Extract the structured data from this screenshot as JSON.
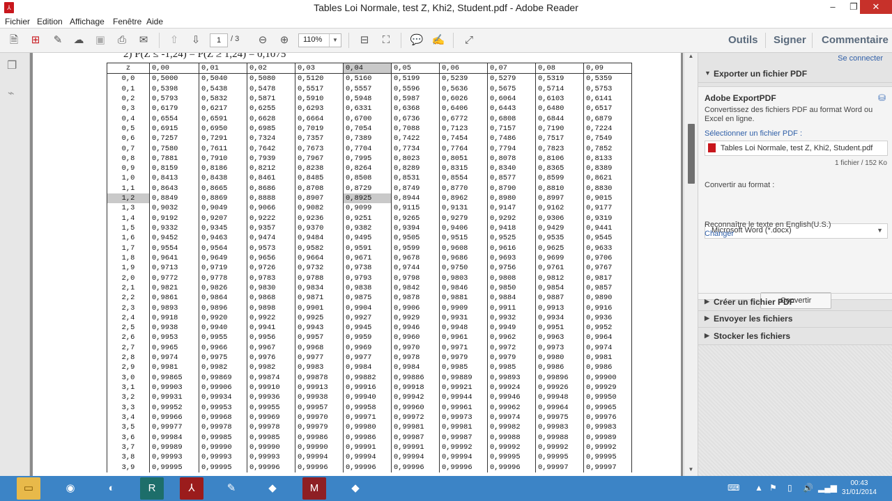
{
  "window": {
    "title": "Tables Loi Normale, test Z, Khi2, Student.pdf - Adobe Reader"
  },
  "menu": [
    "Fichier",
    "Edition",
    "Affichage",
    "Fenêtre",
    "Aide"
  ],
  "toolbar": {
    "page_current": "1",
    "page_total": "/ 3",
    "zoom": "110%"
  },
  "tabs": {
    "outils": "Outils",
    "signer": "Signer",
    "commentaire": "Commentaire"
  },
  "document": {
    "top_formula": "2) P(Z ≤ -1,24) = P(Z ≥ 1,24) = 0,1075",
    "columns": [
      "z",
      "0,00",
      "0,01",
      "0,02",
      "0,03",
      "0,04",
      "0,05",
      "0,06",
      "0,07",
      "0,08",
      "0,09"
    ],
    "rows": [
      [
        "0,0",
        "0,5000",
        "0,5040",
        "0,5080",
        "0,5120",
        "0,5160",
        "0,5199",
        "0,5239",
        "0,5279",
        "0,5319",
        "0,5359"
      ],
      [
        "0,1",
        "0,5398",
        "0,5438",
        "0,5478",
        "0,5517",
        "0,5557",
        "0,5596",
        "0,5636",
        "0,5675",
        "0,5714",
        "0,5753"
      ],
      [
        "0,2",
        "0,5793",
        "0,5832",
        "0,5871",
        "0,5910",
        "0,5948",
        "0,5987",
        "0,6026",
        "0,6064",
        "0,6103",
        "0,6141"
      ],
      [
        "0,3",
        "0,6179",
        "0,6217",
        "0,6255",
        "0,6293",
        "0,6331",
        "0,6368",
        "0,6406",
        "0,6443",
        "0,6480",
        "0,6517"
      ],
      [
        "0,4",
        "0,6554",
        "0,6591",
        "0,6628",
        "0,6664",
        "0,6700",
        "0,6736",
        "0,6772",
        "0,6808",
        "0,6844",
        "0,6879"
      ],
      [
        "0,5",
        "0,6915",
        "0,6950",
        "0,6985",
        "0,7019",
        "0,7054",
        "0,7088",
        "0,7123",
        "0,7157",
        "0,7190",
        "0,7224"
      ],
      [
        "0,6",
        "0,7257",
        "0,7291",
        "0,7324",
        "0,7357",
        "0,7389",
        "0,7422",
        "0,7454",
        "0,7486",
        "0,7517",
        "0,7549"
      ],
      [
        "0,7",
        "0,7580",
        "0,7611",
        "0,7642",
        "0,7673",
        "0,7704",
        "0,7734",
        "0,7764",
        "0,7794",
        "0,7823",
        "0,7852"
      ],
      [
        "0,8",
        "0,7881",
        "0,7910",
        "0,7939",
        "0,7967",
        "0,7995",
        "0,8023",
        "0,8051",
        "0,8078",
        "0,8106",
        "0,8133"
      ],
      [
        "0,9",
        "0,8159",
        "0,8186",
        "0,8212",
        "0,8238",
        "0,8264",
        "0,8289",
        "0,8315",
        "0,8340",
        "0,8365",
        "0,8389"
      ],
      [
        "1,0",
        "0,8413",
        "0,8438",
        "0,8461",
        "0,8485",
        "0,8508",
        "0,8531",
        "0,8554",
        "0,8577",
        "0,8599",
        "0,8621"
      ],
      [
        "1,1",
        "0,8643",
        "0,8665",
        "0,8686",
        "0,8708",
        "0,8729",
        "0,8749",
        "0,8770",
        "0,8790",
        "0,8810",
        "0,8830"
      ],
      [
        "1,2",
        "0,8849",
        "0,8869",
        "0,8888",
        "0,8907",
        "0,8925",
        "0,8944",
        "0,8962",
        "0,8980",
        "0,8997",
        "0,9015"
      ],
      [
        "1,3",
        "0,9032",
        "0,9049",
        "0,9066",
        "0,9082",
        "0,9099",
        "0,9115",
        "0,9131",
        "0,9147",
        "0,9162",
        "0,9177"
      ],
      [
        "1,4",
        "0,9192",
        "0,9207",
        "0,9222",
        "0,9236",
        "0,9251",
        "0,9265",
        "0,9279",
        "0,9292",
        "0,9306",
        "0,9319"
      ],
      [
        "1,5",
        "0,9332",
        "0,9345",
        "0,9357",
        "0,9370",
        "0,9382",
        "0,9394",
        "0,9406",
        "0,9418",
        "0,9429",
        "0,9441"
      ],
      [
        "1,6",
        "0,9452",
        "0,9463",
        "0,9474",
        "0,9484",
        "0,9495",
        "0,9505",
        "0,9515",
        "0,9525",
        "0,9535",
        "0,9545"
      ],
      [
        "1,7",
        "0,9554",
        "0,9564",
        "0,9573",
        "0,9582",
        "0,9591",
        "0,9599",
        "0,9608",
        "0,9616",
        "0,9625",
        "0,9633"
      ],
      [
        "1,8",
        "0,9641",
        "0,9649",
        "0,9656",
        "0,9664",
        "0,9671",
        "0,9678",
        "0,9686",
        "0,9693",
        "0,9699",
        "0,9706"
      ],
      [
        "1,9",
        "0,9713",
        "0,9719",
        "0,9726",
        "0,9732",
        "0,9738",
        "0,9744",
        "0,9750",
        "0,9756",
        "0,9761",
        "0,9767"
      ],
      [
        "2,0",
        "0,9772",
        "0,9778",
        "0,9783",
        "0,9788",
        "0,9793",
        "0,9798",
        "0,9803",
        "0,9808",
        "0,9812",
        "0,9817"
      ],
      [
        "2,1",
        "0,9821",
        "0,9826",
        "0,9830",
        "0,9834",
        "0,9838",
        "0,9842",
        "0,9846",
        "0,9850",
        "0,9854",
        "0,9857"
      ],
      [
        "2,2",
        "0,9861",
        "0,9864",
        "0,9868",
        "0,9871",
        "0,9875",
        "0,9878",
        "0,9881",
        "0,9884",
        "0,9887",
        "0,9890"
      ],
      [
        "2,3",
        "0,9893",
        "0,9896",
        "0,9898",
        "0,9901",
        "0,9904",
        "0,9906",
        "0,9909",
        "0,9911",
        "0,9913",
        "0,9916"
      ],
      [
        "2,4",
        "0,9918",
        "0,9920",
        "0,9922",
        "0,9925",
        "0,9927",
        "0,9929",
        "0,9931",
        "0,9932",
        "0,9934",
        "0,9936"
      ],
      [
        "2,5",
        "0,9938",
        "0,9940",
        "0,9941",
        "0,9943",
        "0,9945",
        "0,9946",
        "0,9948",
        "0,9949",
        "0,9951",
        "0,9952"
      ],
      [
        "2,6",
        "0,9953",
        "0,9955",
        "0,9956",
        "0,9957",
        "0,9959",
        "0,9960",
        "0,9961",
        "0,9962",
        "0,9963",
        "0,9964"
      ],
      [
        "2,7",
        "0,9965",
        "0,9966",
        "0,9967",
        "0,9968",
        "0,9969",
        "0,9970",
        "0,9971",
        "0,9972",
        "0,9973",
        "0,9974"
      ],
      [
        "2,8",
        "0,9974",
        "0,9975",
        "0,9976",
        "0,9977",
        "0,9977",
        "0,9978",
        "0,9979",
        "0,9979",
        "0,9980",
        "0,9981"
      ],
      [
        "2,9",
        "0,9981",
        "0,9982",
        "0,9982",
        "0,9983",
        "0,9984",
        "0,9984",
        "0,9985",
        "0,9985",
        "0,9986",
        "0,9986"
      ],
      [
        "3,0",
        "0,99865",
        "0,99869",
        "0,99874",
        "0,99878",
        "0,99882",
        "0,99886",
        "0,99889",
        "0,99893",
        "0,99896",
        "0,99900"
      ],
      [
        "3,1",
        "0,99903",
        "0,99906",
        "0,99910",
        "0,99913",
        "0,99916",
        "0,99918",
        "0,99921",
        "0,99924",
        "0,99926",
        "0,99929"
      ],
      [
        "3,2",
        "0,99931",
        "0,99934",
        "0,99936",
        "0,99938",
        "0,99940",
        "0,99942",
        "0,99944",
        "0,99946",
        "0,99948",
        "0,99950"
      ],
      [
        "3,3",
        "0,99952",
        "0,99953",
        "0,99955",
        "0,99957",
        "0,99958",
        "0,99960",
        "0,99961",
        "0,99962",
        "0,99964",
        "0,99965"
      ],
      [
        "3,4",
        "0,99966",
        "0,99968",
        "0,99969",
        "0,99970",
        "0,99971",
        "0,99972",
        "0,99973",
        "0,99974",
        "0,99975",
        "0,99976"
      ],
      [
        "3,5",
        "0,99977",
        "0,99978",
        "0,99978",
        "0,99979",
        "0,99980",
        "0,99981",
        "0,99981",
        "0,99982",
        "0,99983",
        "0,99983"
      ],
      [
        "3,6",
        "0,99984",
        "0,99985",
        "0,99985",
        "0,99986",
        "0,99986",
        "0,99987",
        "0,99987",
        "0,99988",
        "0,99988",
        "0,99989"
      ],
      [
        "3,7",
        "0,99989",
        "0,99990",
        "0,99990",
        "0,99990",
        "0,99991",
        "0,99991",
        "0,99992",
        "0,99992",
        "0,99992",
        "0,99992"
      ],
      [
        "3,8",
        "0,99993",
        "0,99993",
        "0,99993",
        "0,99994",
        "0,99994",
        "0,99994",
        "0,99994",
        "0,99995",
        "0,99995",
        "0,99995"
      ],
      [
        "3,9",
        "0,99995",
        "0,99995",
        "0,99996",
        "0,99996",
        "0,99996",
        "0,99996",
        "0,99996",
        "0,99996",
        "0,99997",
        "0,99997"
      ]
    ],
    "highlight_row": "1,2",
    "highlight_col": "0,04"
  },
  "side_panel": {
    "connect_link": "Se connecter",
    "export_header": "Exporter un fichier PDF",
    "export_title": "Adobe ExportPDF",
    "export_desc_1": "Convertissez des fichiers PDF au format Word ou",
    "export_desc_2": "Excel en ligne.",
    "select_label": "Sélectionner un fichier PDF :",
    "file_name": "Tables Loi Normale, test Z, Khi2, Student.pdf",
    "file_info": "1 fichier / 152 Ko",
    "convert_label": "Convertir au format :",
    "format": "Microsoft Word (*.docx)",
    "recognize": "Reconnaître le texte en English(U.S.)",
    "change_link": "Changer",
    "convert_button": "Convertir",
    "sections": [
      "Créer un fichier PDF",
      "Envoyer les fichiers",
      "Stocker les fichiers"
    ]
  },
  "taskbar": {
    "time": "00:43",
    "date": "31/01/2014"
  }
}
